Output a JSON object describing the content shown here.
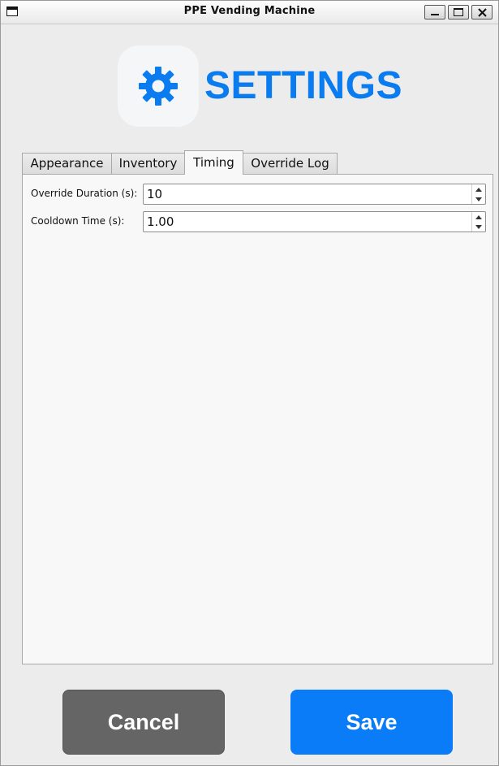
{
  "window": {
    "title": "PPE Vending Machine"
  },
  "header": {
    "title": "SETTINGS",
    "icon": "gear-icon",
    "accent_color": "#0a7cf0"
  },
  "tabs": [
    {
      "label": "Appearance",
      "active": false
    },
    {
      "label": "Inventory",
      "active": false
    },
    {
      "label": "Timing",
      "active": true
    },
    {
      "label": "Override Log",
      "active": false
    }
  ],
  "timing": {
    "override_duration": {
      "label": "Override Duration (s):",
      "value": "10"
    },
    "cooldown_time": {
      "label": "Cooldown Time (s):",
      "value": "1.00"
    }
  },
  "actions": {
    "cancel_label": "Cancel",
    "save_label": "Save",
    "cancel_color": "#656565",
    "save_color": "#0a7cf8"
  }
}
